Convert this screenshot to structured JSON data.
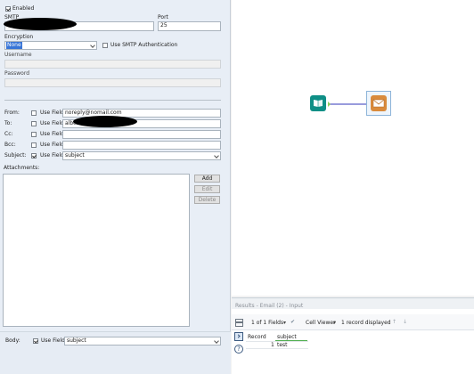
{
  "config": {
    "enabled_label": "Enabled",
    "enabled_checked": true,
    "smtp_label": "SMTP",
    "smtp_value": "",
    "port_label": "Port",
    "port_value": "25",
    "encryption_label": "Encryption",
    "encryption_value": "None",
    "smtp_auth_label": "Use SMTP Authentication",
    "username_label": "Username",
    "password_label": "Password",
    "from_label": "From:",
    "to_label": "To:",
    "cc_label": "Cc:",
    "bcc_label": "Bcc:",
    "subject_label": "Subject:",
    "use_field_label": "Use Field",
    "from_value": "noreply@nomail.com",
    "to_value": "albert",
    "subject_value": "subject",
    "attachments_label": "Attachments:",
    "add_label": "Add",
    "edit_label": "Edit",
    "delete_label": "Delete",
    "body_label": "Body:",
    "body_value": "subject"
  },
  "canvas": {
    "tools": [
      {
        "name": "input-tool",
        "icon": "book-icon",
        "color": "#0f8f86"
      },
      {
        "name": "email-tool",
        "icon": "envelope-icon",
        "color": "#d98b3c"
      }
    ],
    "connector_color": "#5b5fc7"
  },
  "results": {
    "title": "Results - Email (2) - Input",
    "fields_label": "1 of 1 Fields",
    "cell_viewer_label": "Cell Viewer",
    "records_label": "1 record displayed",
    "columns": [
      "Record",
      "subject"
    ],
    "rows": [
      [
        "1",
        "test"
      ]
    ]
  }
}
